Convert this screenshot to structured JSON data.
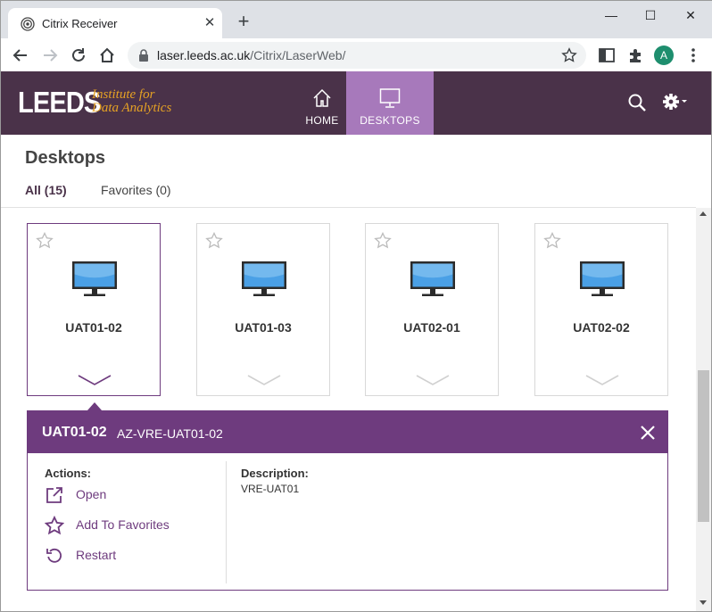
{
  "browser": {
    "tab_title": "Citrix Receiver",
    "tab_close": "✕",
    "new_tab": "+",
    "url_host": "laser.leeds.ac.uk",
    "url_path": "/Citrix/LaserWeb/",
    "profile_initial": "A",
    "window_controls": {
      "minimize": "—",
      "maximize": "☐",
      "close": "✕"
    }
  },
  "header": {
    "logo_text": "LEEDS",
    "logo_institute_line1": "Institute for",
    "logo_institute_line2": "Data Analytics",
    "nav": [
      {
        "label": "HOME",
        "icon": "home-icon",
        "active": false
      },
      {
        "label": "DESKTOPS",
        "icon": "monitor-icon",
        "active": true
      }
    ],
    "accent_color": "#4a3249",
    "active_nav_color": "#a779bb"
  },
  "page": {
    "title": "Desktops",
    "filters": [
      {
        "label": "All (15)",
        "active": true
      },
      {
        "label": "Favorites (0)",
        "active": false
      }
    ]
  },
  "desktops": [
    {
      "name": "UAT01-02",
      "selected": true
    },
    {
      "name": "UAT01-03",
      "selected": false
    },
    {
      "name": "UAT02-01",
      "selected": false
    },
    {
      "name": "UAT02-02",
      "selected": false
    }
  ],
  "details": {
    "name": "UAT01-02",
    "subtitle": "AZ-VRE-UAT01-02",
    "actions_label": "Actions:",
    "actions": [
      {
        "label": "Open",
        "icon": "open-external-icon"
      },
      {
        "label": "Add To Favorites",
        "icon": "star-icon"
      },
      {
        "label": "Restart",
        "icon": "restart-icon"
      }
    ],
    "description_label": "Description:",
    "description_value": "VRE-UAT01",
    "panel_color": "#6e3b7e"
  }
}
